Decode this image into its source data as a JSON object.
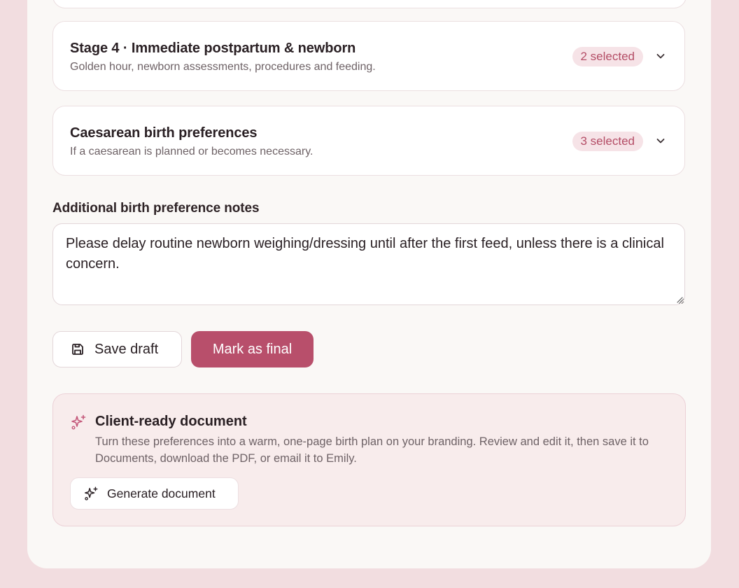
{
  "stages": [
    {
      "title": "Stage 4 · Immediate postpartum & newborn",
      "subtitle": "Golden hour, newborn assessments, procedures and feeding.",
      "badge": "2 selected"
    },
    {
      "title": "Caesarean birth preferences",
      "subtitle": "If a caesarean is planned or becomes necessary.",
      "badge": "3 selected"
    }
  ],
  "notes": {
    "label": "Additional birth preference notes",
    "value": "Please delay routine newborn weighing/dressing until after the first feed, unless there is a clinical concern."
  },
  "actions": {
    "save_label": "Save draft",
    "final_label": "Mark as final"
  },
  "document": {
    "title": "Client-ready document",
    "description": "Turn these preferences into a warm, one-page birth plan on your branding. Review and edit it, then save it to Documents, download the PDF, or email it to Emily.",
    "generate_label": "Generate document",
    "icon": "sparkles-icon"
  },
  "colors": {
    "accent": "#b84f6b",
    "badge_bg": "#f6e3e7",
    "badge_text": "#b44d66",
    "page_bg": "#f2dde0",
    "panel_bg": "#faf8f6",
    "doc_card_bg": "#f8ecec"
  }
}
